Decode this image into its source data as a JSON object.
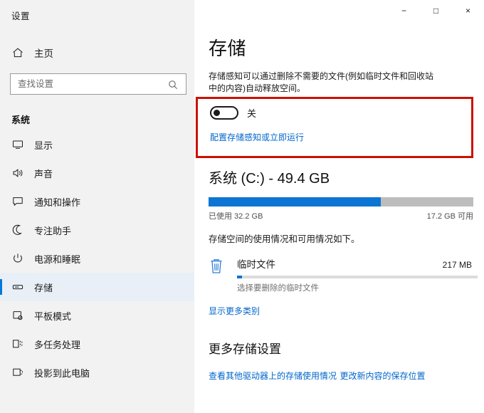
{
  "window": {
    "app_title": "设置",
    "controls": {
      "minimize": "−",
      "maximize": "□",
      "close": "×"
    }
  },
  "sidebar": {
    "home_label": "主页",
    "home_icon": "home-icon",
    "search": {
      "placeholder": "查找设置",
      "value": "",
      "icon": "search-icon"
    },
    "section_title": "系统",
    "items": [
      {
        "label": "显示",
        "icon": "monitor-icon",
        "selected": false
      },
      {
        "label": "声音",
        "icon": "speaker-icon",
        "selected": false
      },
      {
        "label": "通知和操作",
        "icon": "speech-bubble-icon",
        "selected": false
      },
      {
        "label": "专注助手",
        "icon": "moon-icon",
        "selected": false
      },
      {
        "label": "电源和睡眠",
        "icon": "power-icon",
        "selected": false
      },
      {
        "label": "存储",
        "icon": "drive-icon",
        "selected": true
      },
      {
        "label": "平板模式",
        "icon": "tablet-icon",
        "selected": false
      },
      {
        "label": "多任务处理",
        "icon": "multitask-icon",
        "selected": false
      },
      {
        "label": "投影到此电脑",
        "icon": "project-icon",
        "selected": false
      }
    ]
  },
  "main": {
    "page_title": "存储",
    "description": "存储感知可以通过删除不需要的文件(例如临时文件和回收站中的内容)自动释放空间。",
    "storage_sense": {
      "toggle_state_label": "关",
      "toggle_on": false,
      "config_link": "配置存储感知或立即运行"
    },
    "highlight_color": "#cc1100",
    "drive": {
      "title": "系统 (C:) - 49.4 GB",
      "used_label": "已使用 32.2 GB",
      "free_label": "17.2 GB 可用",
      "used_percent": 65,
      "bar_color": "#0c75d3",
      "track_color": "#bdbdbd",
      "note": "存储空间的使用情况和可用情况如下。"
    },
    "categories": [
      {
        "name": "临时文件",
        "size": "217 MB",
        "subtitle": "选择要删除的临时文件",
        "icon": "trash-icon",
        "bar_percent": 2
      }
    ],
    "show_more_link": "显示更多类别",
    "more_settings": {
      "heading": "更多存储设置",
      "links": [
        "查看其他驱动器上的存储使用情况",
        "更改新内容的保存位置"
      ]
    }
  }
}
